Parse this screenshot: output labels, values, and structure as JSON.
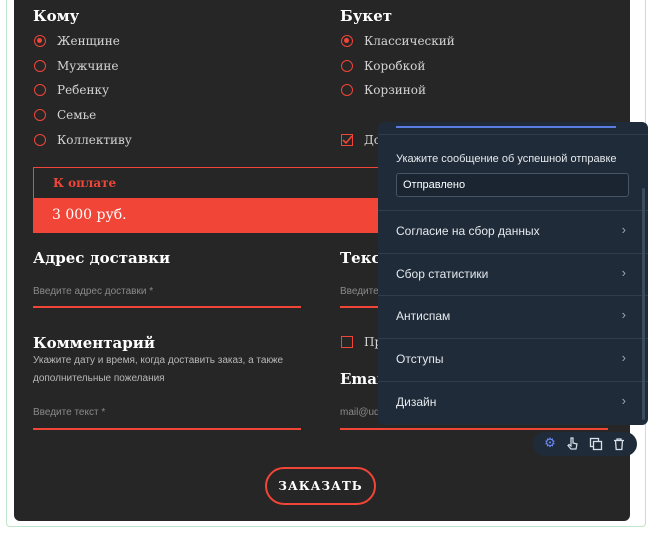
{
  "form": {
    "recipient": {
      "heading": "Кому",
      "options": [
        {
          "label": "Женщине",
          "selected": true
        },
        {
          "label": "Мужчине",
          "selected": false
        },
        {
          "label": "Ребенку",
          "selected": false
        },
        {
          "label": "Семье",
          "selected": false
        },
        {
          "label": "Коллективу",
          "selected": false
        }
      ]
    },
    "bouquet": {
      "heading": "Букет",
      "options": [
        {
          "label": "Классический",
          "selected": true
        },
        {
          "label": "Коробкой",
          "selected": false
        },
        {
          "label": "Корзиной",
          "selected": false
        }
      ],
      "checkbox_label": "До"
    },
    "payment": {
      "label": "К оплате",
      "amount": "3 000 руб."
    },
    "address": {
      "heading": "Адрес доставки",
      "placeholder": "Введите адрес доставки *"
    },
    "text_field": {
      "heading": "Текст",
      "placeholder": "Введите"
    },
    "comment": {
      "heading": "Комментарий",
      "hint": "Укажите дату и время, когда доставить заказ, а также дополнительные пожелания",
      "placeholder": "Введите текст *"
    },
    "agree_label": "Пр",
    "email": {
      "heading": "Email",
      "placeholder": "mail@ud"
    },
    "submit_label": "ЗАКАЗАТЬ"
  },
  "settings_panel": {
    "success_caption": "Укажите сообщение об успешной отправке",
    "success_value": "Отправлено",
    "rows": [
      {
        "label": "Согласие на сбор данных"
      },
      {
        "label": "Сбор статистики"
      },
      {
        "label": "Антиспам"
      },
      {
        "label": "Отступы"
      },
      {
        "label": "Дизайн"
      }
    ]
  },
  "toolbar": {
    "icons": [
      "gear-icon",
      "pointer-icon",
      "duplicate-icon",
      "trash-icon"
    ]
  },
  "colors": {
    "accent": "#f04537",
    "form_bg": "#262626",
    "panel_bg": "#1f2b38"
  }
}
